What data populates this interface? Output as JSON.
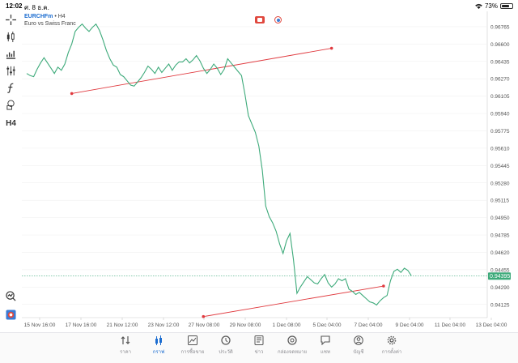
{
  "status_bar": {
    "time": "12:02",
    "date": "ศ. 8 ธ.ค.",
    "battery": "73%",
    "battery_level": 0.73
  },
  "symbol": {
    "name": "EURCHFm",
    "separator": "•",
    "timeframe": "H4",
    "description": "Euro vs Swiss Franc"
  },
  "toolbar": {
    "timeframe_label": "H4"
  },
  "colors": {
    "price_line": "#3daa7a",
    "trend_line": "#e0393e",
    "current_price_bg": "#3daa7a",
    "grid": "#eeeeee",
    "accent": "#1c6dd0"
  },
  "chart_data": {
    "type": "line",
    "series": [
      {
        "values": [
          0.9632,
          0.963,
          0.9629,
          0.9636,
          0.9642,
          0.9647,
          0.9642,
          0.9637,
          0.9632,
          0.9638,
          0.9635,
          0.9641,
          0.9652,
          0.966,
          0.9672,
          0.9676,
          0.9679,
          0.9675,
          0.9672,
          0.9676,
          0.9679,
          0.9673,
          0.9664,
          0.9654,
          0.9646,
          0.964,
          0.9638,
          0.9631,
          0.9629,
          0.9625,
          0.9621,
          0.962,
          0.9624,
          0.9628,
          0.9633,
          0.9639,
          0.9636,
          0.9632,
          0.9638,
          0.9633,
          0.9637,
          0.9641,
          0.9635,
          0.964,
          0.9643,
          0.9643,
          0.9646,
          0.9642,
          0.9645,
          0.9649,
          0.9644,
          0.9637,
          0.9632,
          0.9636,
          0.9641,
          0.9637,
          0.9631,
          0.9636,
          0.9646,
          0.9642,
          0.9638,
          0.9634,
          0.963,
          0.9612,
          0.9592,
          0.9584,
          0.9576,
          0.9563,
          0.954,
          0.9506,
          0.9496,
          0.949,
          0.9482,
          0.947,
          0.9461,
          0.9473,
          0.948,
          0.9455,
          0.9423,
          0.9429,
          0.9434,
          0.9439,
          0.9436,
          0.9433,
          0.9432,
          0.9437,
          0.9441,
          0.9433,
          0.9429,
          0.9432,
          0.9437,
          0.9435,
          0.9437,
          0.9427,
          0.9425,
          0.9422,
          0.9424,
          0.9421,
          0.9418,
          0.9415,
          0.9414,
          0.9412,
          0.9416,
          0.9419,
          0.9421,
          0.9435,
          0.9444,
          0.9446,
          0.9443,
          0.9447,
          0.9445,
          0.944
        ]
      }
    ],
    "y_ticks": [
      "0.96765",
      "0.96600",
      "0.96435",
      "0.96270",
      "0.96105",
      "0.95940",
      "0.95775",
      "0.95610",
      "0.95445",
      "0.95280",
      "0.95115",
      "0.94950",
      "0.94785",
      "0.94620",
      "0.94455",
      "0.94290",
      "0.94125"
    ],
    "ylim": [
      0.94,
      0.9688
    ],
    "x_tick_labels": [
      "15 Nov 16:00",
      "17 Nov 16:00",
      "21 Nov 12:00",
      "23 Nov 12:00",
      "27 Nov 08:00",
      "29 Nov 08:00",
      "1 Dec 08:00",
      "5 Dec 04:00",
      "7 Dec 04:00",
      "9 Dec 04:00",
      "11 Dec 04:00",
      "13 Dec 04:00"
    ],
    "current_price": "0.94395",
    "current_price_value": 0.94395,
    "trend_lines": [
      {
        "x1_index": 13,
        "y1": 0.9613,
        "x2_index": 88,
        "y2": 0.9656
      },
      {
        "x1_index": 51,
        "y1": 0.9401,
        "x2_index": 103,
        "y2": 0.943
      }
    ],
    "grid": true
  },
  "tabs": [
    {
      "id": "quotes",
      "label": "ราคา",
      "icon": "quotes-icon",
      "active": false
    },
    {
      "id": "chart",
      "label": "กราฟ",
      "icon": "candlestick-icon",
      "active": true
    },
    {
      "id": "trade",
      "label": "การซื้อขาย",
      "icon": "trade-chart-icon",
      "active": false
    },
    {
      "id": "history",
      "label": "ประวัติ",
      "icon": "history-icon",
      "active": false
    },
    {
      "id": "news",
      "label": "ข่าว",
      "icon": "news-icon",
      "active": false
    },
    {
      "id": "mailbox",
      "label": "กล่องจดหมาย",
      "icon": "at-icon",
      "active": false
    },
    {
      "id": "chat",
      "label": "แชท",
      "icon": "chat-icon",
      "active": false
    },
    {
      "id": "accounts",
      "label": "บัญชี",
      "icon": "account-icon",
      "active": false
    },
    {
      "id": "settings",
      "label": "การตั้งค่า",
      "icon": "gear-icon",
      "active": false
    }
  ]
}
